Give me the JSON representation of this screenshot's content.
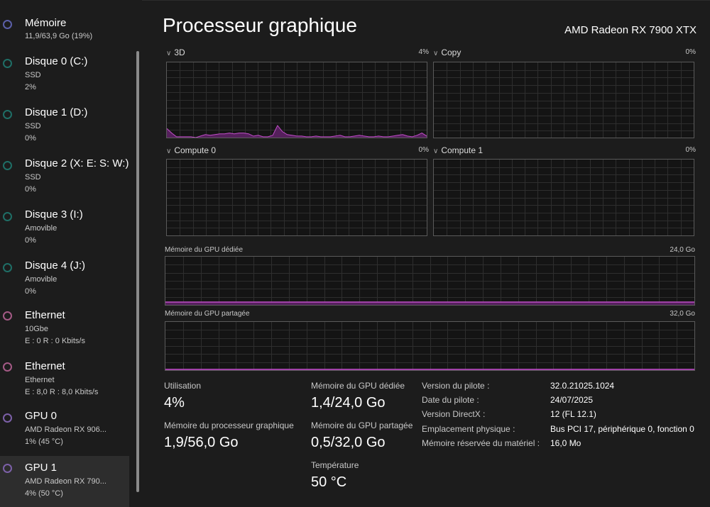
{
  "sidebar": {
    "items": [
      {
        "title": "Mémoire",
        "sub1": "11,9/63,9 Go (19%)",
        "sub2": "",
        "color": "#5b5fa8"
      },
      {
        "title": "Disque 0 (C:)",
        "sub1": "SSD",
        "sub2": "2%",
        "color": "#1f6e66"
      },
      {
        "title": "Disque 1 (D:)",
        "sub1": "SSD",
        "sub2": "0%",
        "color": "#1f6e66"
      },
      {
        "title": "Disque 2 (X: E: S: W:)",
        "sub1": "SSD",
        "sub2": "0%",
        "color": "#1f6e66"
      },
      {
        "title": "Disque 3 (I:)",
        "sub1": "Amovible",
        "sub2": "0%",
        "color": "#1f6e66"
      },
      {
        "title": "Disque 4 (J:)",
        "sub1": "Amovible",
        "sub2": "0%",
        "color": "#1f6e66"
      },
      {
        "title": "Ethernet",
        "sub1": "10Gbe",
        "sub2": "E : 0 R : 0 Kbits/s",
        "color": "#a45a86"
      },
      {
        "title": "Ethernet",
        "sub1": "Ethernet",
        "sub2": "E : 8,0 R : 8,0 Kbits/s",
        "color": "#a45a86"
      },
      {
        "title": "GPU 0",
        "sub1": "AMD Radeon RX 906...",
        "sub2": "1% (45 °C)",
        "color": "#7c60a8"
      },
      {
        "title": "GPU 1",
        "sub1": "AMD Radeon RX 790...",
        "sub2": "4% (50 °C)",
        "color": "#7c60a8"
      }
    ],
    "active_index": 9
  },
  "header": {
    "title": "Processeur graphique",
    "device": "AMD Radeon RX 7900 XTX"
  },
  "engines": [
    {
      "name": "3D",
      "percent": "4%"
    },
    {
      "name": "Copy",
      "percent": "0%"
    },
    {
      "name": "Compute 0",
      "percent": "0%"
    },
    {
      "name": "Compute 1",
      "percent": "0%"
    }
  ],
  "memory_graphs": {
    "dedicated": {
      "label": "Mémoire du GPU dédiée",
      "max": "24,0 Go"
    },
    "shared": {
      "label": "Mémoire du GPU partagée",
      "max": "32,0 Go"
    }
  },
  "stats": {
    "utilisation": {
      "label": "Utilisation",
      "value": "4%"
    },
    "gpu_proc_mem": {
      "label": "Mémoire du processeur graphique",
      "value": "1,9/56,0 Go"
    },
    "dedicated": {
      "label": "Mémoire du GPU dédiée",
      "value": "1,4/24,0 Go"
    },
    "shared": {
      "label": "Mémoire du GPU partagée",
      "value": "0,5/32,0 Go"
    },
    "temperature": {
      "label": "Température",
      "value": "50 °C"
    }
  },
  "info": [
    {
      "key": "Version du pilote :",
      "value": "32.0.21025.1024"
    },
    {
      "key": "Date du pilote :",
      "value": "24/07/2025"
    },
    {
      "key": "Version DirectX :",
      "value": "12 (FL 12.1)"
    },
    {
      "key": "Emplacement physique :",
      "value": "Bus PCI 17, périphérique 0, fonction 0"
    },
    {
      "key": "Mémoire réservée du matériel :",
      "value": "16,0 Mo"
    }
  ],
  "graph_series": {
    "engine_3d": [
      12,
      6,
      1,
      1,
      1,
      1,
      0,
      2,
      4,
      3,
      4,
      5,
      5,
      6,
      5,
      6,
      6,
      5,
      2,
      3,
      1,
      1,
      3,
      16,
      8,
      4,
      3,
      2,
      2,
      1,
      1,
      2,
      1,
      1,
      1,
      2,
      3,
      1,
      1,
      2,
      3,
      2,
      1,
      1,
      2,
      1,
      1,
      2,
      3,
      4,
      2,
      1,
      3,
      6,
      2
    ],
    "dedicated_level": 0.058,
    "shared_level": 0.016
  },
  "colors": {
    "gpu_line": "#c04ec8",
    "gpu_fill": "#55205c",
    "grid": "#2e2e2e"
  }
}
